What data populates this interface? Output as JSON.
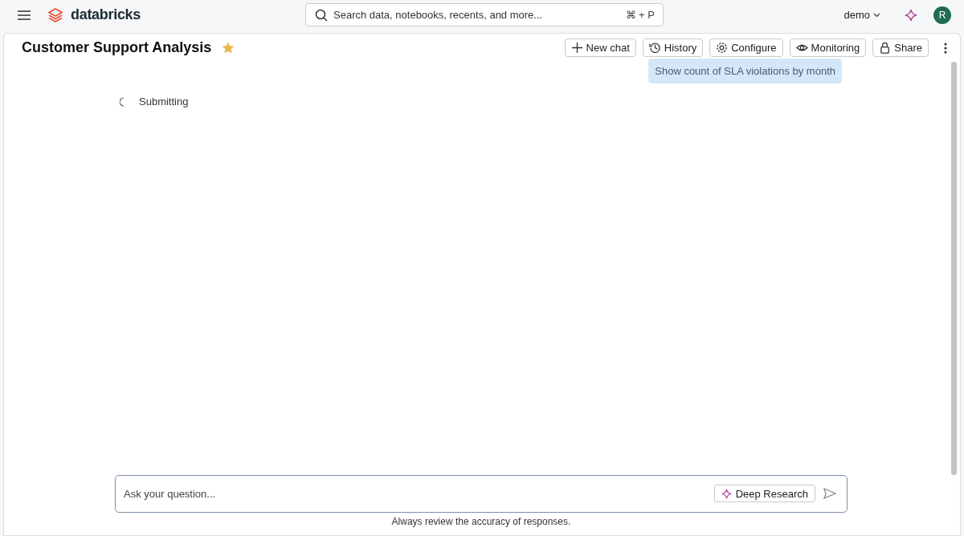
{
  "brand": "databricks",
  "search": {
    "placeholder": "Search data, notebooks, recents, and more...",
    "shortcut": "⌘ + P"
  },
  "workspace": "demo",
  "avatar": "R",
  "page": {
    "title": "Customer Support Analysis",
    "favorite": true
  },
  "actions": [
    {
      "kind": "plus",
      "label": "New chat"
    },
    {
      "kind": "history",
      "label": "History"
    },
    {
      "kind": "gear",
      "label": "Configure"
    },
    {
      "kind": "eye",
      "label": "Monitoring"
    },
    {
      "kind": "lock",
      "label": "Share"
    }
  ],
  "messages": [
    {
      "kind": "user",
      "text": "Show count of SLA violations by month"
    },
    {
      "kind": "status",
      "text": "Submitting"
    }
  ],
  "composer": {
    "placeholder": "Ask your question...",
    "deep_research": "Deep Research",
    "disclaimer": "Always review the accuracy of responses."
  }
}
